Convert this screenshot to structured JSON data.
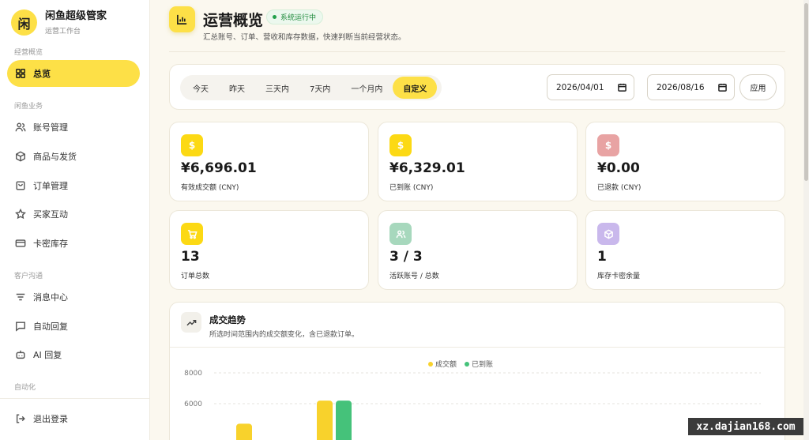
{
  "brand": {
    "logo": "闲",
    "name": "闲鱼超级管家",
    "subtitle": "运营工作台"
  },
  "sidebar": {
    "groups": [
      "经营概览",
      "闲鱼业务",
      "客户沟通",
      "自动化"
    ],
    "items": [
      {
        "label": "总览",
        "icon": "grid-icon",
        "active": true
      },
      {
        "label": "账号管理",
        "icon": "users-icon"
      },
      {
        "label": "商品与发货",
        "icon": "box-icon"
      },
      {
        "label": "订单管理",
        "icon": "bag-icon"
      },
      {
        "label": "买家互动",
        "icon": "star-icon"
      },
      {
        "label": "卡密库存",
        "icon": "card-icon"
      },
      {
        "label": "消息中心",
        "icon": "list-icon"
      },
      {
        "label": "自动回复",
        "icon": "chat-icon"
      },
      {
        "label": "AI 回复",
        "icon": "bot-icon"
      }
    ],
    "logout": "退出登录"
  },
  "header": {
    "title": "运营概览",
    "status": "系统运行中",
    "description": "汇总账号、订单、营收和库存数据，快速判断当前经营状态。"
  },
  "filter": {
    "ranges": [
      "今天",
      "昨天",
      "三天内",
      "7天内",
      "一个月内",
      "自定义"
    ],
    "active_range": "自定义",
    "start_date": "2026/04/01",
    "separator": "-",
    "end_date": "2026/08/16",
    "apply_label": "应用"
  },
  "stats": [
    {
      "value": "¥6,696.01",
      "label": "有效成交额 (CNY)",
      "icon": "dollar-icon",
      "color": "#fcd914"
    },
    {
      "value": "¥6,329.01",
      "label": "已到账 (CNY)",
      "icon": "dollar-icon",
      "color": "#fcd914"
    },
    {
      "value": "¥0.00",
      "label": "已退款 (CNY)",
      "icon": "dollar-icon",
      "color": "#e8a3a3"
    },
    {
      "value": "13",
      "label": "订单总数",
      "icon": "cart-icon",
      "color": "#fcd914"
    },
    {
      "value": "3 / 3",
      "label": "活跃账号 / 总数",
      "icon": "users-icon",
      "color": "#a7d8bd"
    },
    {
      "value": "1",
      "label": "库存卡密余量",
      "icon": "cube-icon",
      "color": "#c9b8ec"
    }
  ],
  "trend": {
    "title": "成交趋势",
    "description": "所选时间范围内的成交额变化，含已退款订单。"
  },
  "chart_data": {
    "type": "bar",
    "series": [
      {
        "name": "成交额",
        "color": "#f8d22c",
        "values": [
          4700,
          6200
        ]
      },
      {
        "name": "已到账",
        "color": "#45c27a",
        "values": [
          null,
          6200
        ]
      }
    ],
    "categories": [
      "",
      ""
    ],
    "yticks": [
      6000,
      8000
    ],
    "ylim": [
      0,
      8000
    ],
    "grid": true,
    "legend": "top-center"
  },
  "watermark": "xz.dajian168.com"
}
